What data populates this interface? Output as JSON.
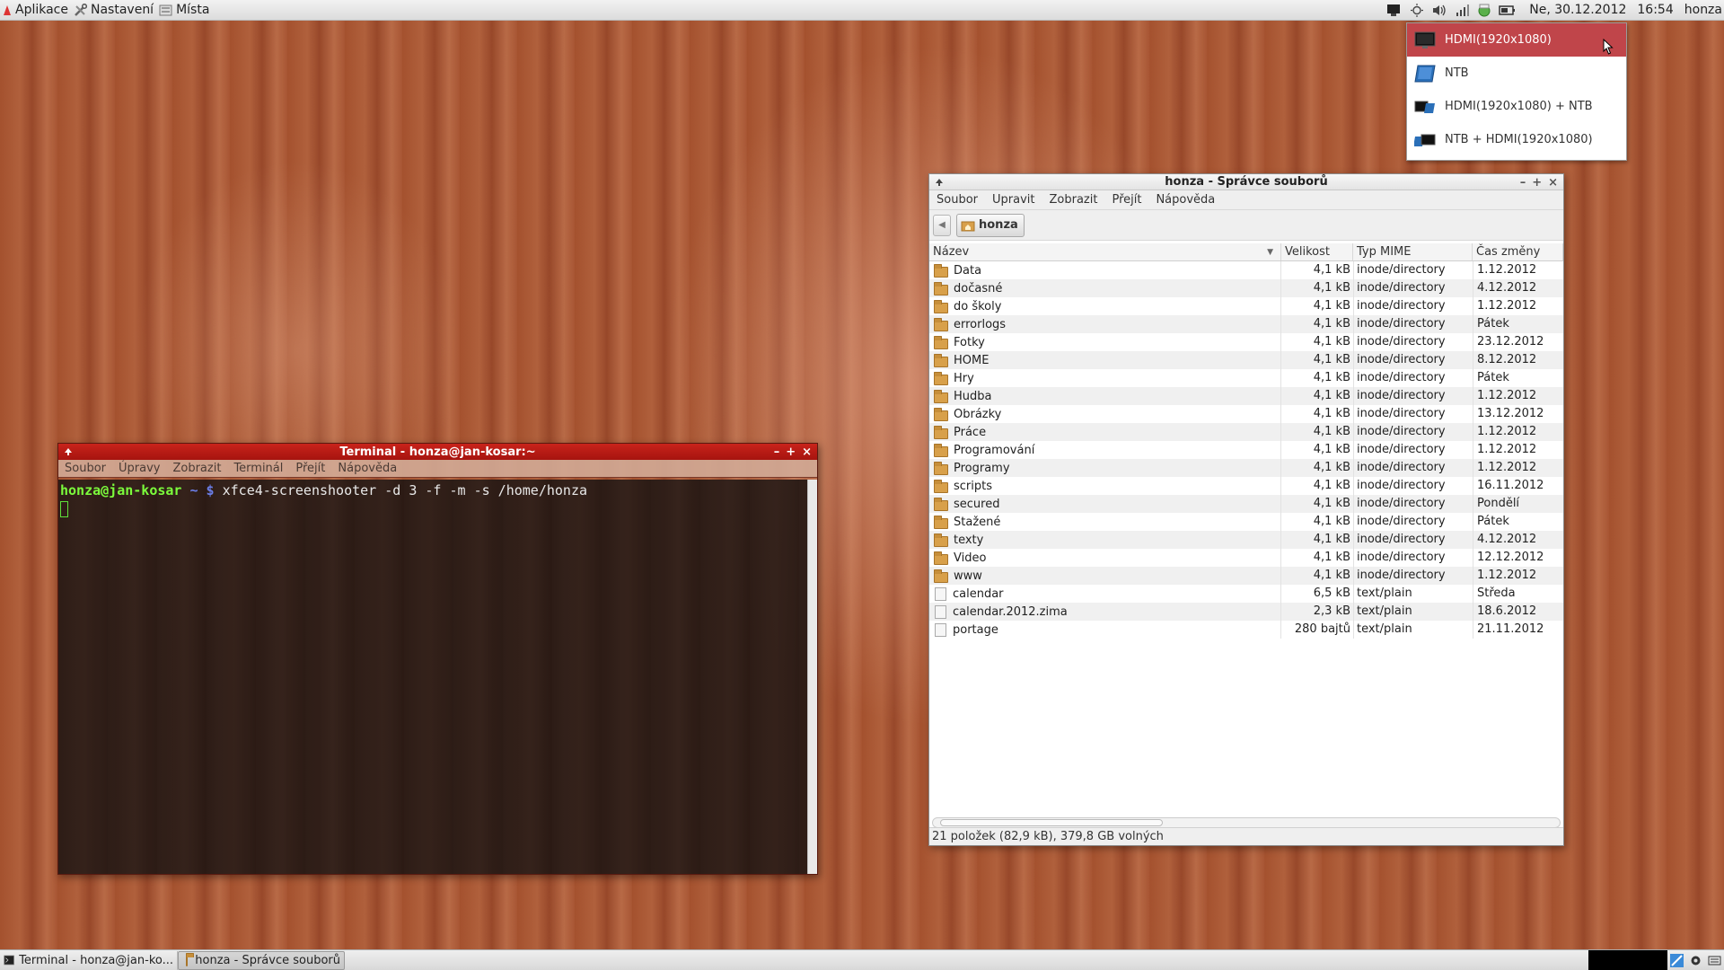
{
  "top_panel": {
    "menus": [
      {
        "name": "applications",
        "label": "Aplikace"
      },
      {
        "name": "settings",
        "label": "Nastavení"
      },
      {
        "name": "places",
        "label": "Místa"
      }
    ],
    "date": "Ne, 30.12.2012",
    "time": "16:54",
    "user": "honza"
  },
  "display_menu": {
    "items": [
      {
        "label": "HDMI(1920x1080)",
        "selected": true
      },
      {
        "label": "NTB",
        "selected": false
      },
      {
        "label": "HDMI(1920x1080) + NTB",
        "selected": false
      },
      {
        "label": "NTB + HDMI(1920x1080)",
        "selected": false
      }
    ]
  },
  "file_manager": {
    "title": "honza - Správce souborů",
    "menu": [
      "Soubor",
      "Upravit",
      "Zobrazit",
      "Přejít",
      "Nápověda"
    ],
    "path_button": "honza",
    "columns": {
      "name": "Název",
      "size": "Velikost",
      "mime": "Typ MIME",
      "modified": "Čas změny"
    },
    "rows": [
      {
        "name": "Data",
        "size": "4,1 kB",
        "mime": "inode/directory",
        "modified": "1.12.2012",
        "type": "folder"
      },
      {
        "name": "dočasné",
        "size": "4,1 kB",
        "mime": "inode/directory",
        "modified": "4.12.2012",
        "type": "folder"
      },
      {
        "name": "do školy",
        "size": "4,1 kB",
        "mime": "inode/directory",
        "modified": "1.12.2012",
        "type": "folder"
      },
      {
        "name": "errorlogs",
        "size": "4,1 kB",
        "mime": "inode/directory",
        "modified": "Pátek",
        "type": "folder"
      },
      {
        "name": "Fotky",
        "size": "4,1 kB",
        "mime": "inode/directory",
        "modified": "23.12.2012",
        "type": "folder"
      },
      {
        "name": "HOME",
        "size": "4,1 kB",
        "mime": "inode/directory",
        "modified": "8.12.2012",
        "type": "folder"
      },
      {
        "name": "Hry",
        "size": "4,1 kB",
        "mime": "inode/directory",
        "modified": "Pátek",
        "type": "folder"
      },
      {
        "name": "Hudba",
        "size": "4,1 kB",
        "mime": "inode/directory",
        "modified": "1.12.2012",
        "type": "folder"
      },
      {
        "name": "Obrázky",
        "size": "4,1 kB",
        "mime": "inode/directory",
        "modified": "13.12.2012",
        "type": "folder"
      },
      {
        "name": "Práce",
        "size": "4,1 kB",
        "mime": "inode/directory",
        "modified": "1.12.2012",
        "type": "folder"
      },
      {
        "name": "Programování",
        "size": "4,1 kB",
        "mime": "inode/directory",
        "modified": "1.12.2012",
        "type": "folder"
      },
      {
        "name": "Programy",
        "size": "4,1 kB",
        "mime": "inode/directory",
        "modified": "1.12.2012",
        "type": "folder"
      },
      {
        "name": "scripts",
        "size": "4,1 kB",
        "mime": "inode/directory",
        "modified": "16.11.2012",
        "type": "folder"
      },
      {
        "name": "secured",
        "size": "4,1 kB",
        "mime": "inode/directory",
        "modified": "Pondělí",
        "type": "folder"
      },
      {
        "name": "Stažené",
        "size": "4,1 kB",
        "mime": "inode/directory",
        "modified": "Pátek",
        "type": "folder"
      },
      {
        "name": "texty",
        "size": "4,1 kB",
        "mime": "inode/directory",
        "modified": "4.12.2012",
        "type": "folder"
      },
      {
        "name": "Video",
        "size": "4,1 kB",
        "mime": "inode/directory",
        "modified": "12.12.2012",
        "type": "folder"
      },
      {
        "name": "www",
        "size": "4,1 kB",
        "mime": "inode/directory",
        "modified": "1.12.2012",
        "type": "folder"
      },
      {
        "name": "calendar",
        "size": "6,5 kB",
        "mime": "text/plain",
        "modified": "Středa",
        "type": "file"
      },
      {
        "name": "calendar.2012.zima",
        "size": "2,3 kB",
        "mime": "text/plain",
        "modified": "18.6.2012",
        "type": "file"
      },
      {
        "name": "portage",
        "size": "280 bajtů",
        "mime": "text/plain",
        "modified": "21.11.2012",
        "type": "file"
      }
    ],
    "status": "21 položek (82,9 kB), 379,8 GB volných"
  },
  "terminal": {
    "title": "Terminal - honza@jan-kosar:~",
    "menu": [
      "Soubor",
      "Úpravy",
      "Zobrazit",
      "Terminál",
      "Přejít",
      "Nápověda"
    ],
    "prompt_user": "honza@jan-kosar",
    "prompt_path": "~ $",
    "command": "xfce4-screenshooter -d 3 -f -m -s /home/honza"
  },
  "taskbar": {
    "tasks": [
      {
        "label": "Terminal - honza@jan-ko...",
        "icon": "terminal-icon"
      },
      {
        "label": "honza - Správce souborů",
        "icon": "folder-icon"
      }
    ]
  },
  "colors": {
    "menu_selected": "#c0454a",
    "terminal_title": "#b81c15",
    "prompt_user": "#7cfc3c",
    "prompt_path": "#6b7ee8"
  }
}
